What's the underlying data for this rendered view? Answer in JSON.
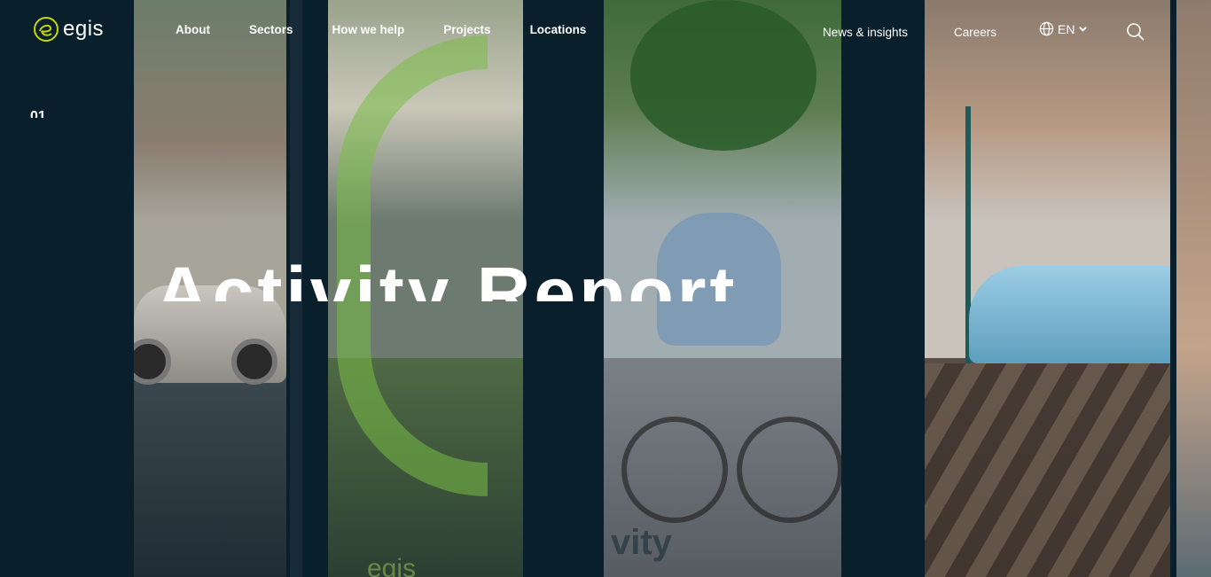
{
  "brand": {
    "name": "egis",
    "accent": "#c5d600",
    "background": "#0a1f2c"
  },
  "nav": {
    "primary": [
      {
        "label": "About"
      },
      {
        "label": "Sectors"
      },
      {
        "label": "How we help"
      },
      {
        "label": "Projects"
      },
      {
        "label": "Locations"
      }
    ],
    "secondary": [
      {
        "label": "News & insights"
      },
      {
        "label": "Careers"
      }
    ],
    "language": {
      "label": "EN",
      "icon": "globe-icon"
    },
    "search": {
      "icon": "search-icon"
    }
  },
  "hero": {
    "slide_number": "01",
    "title": "Activity Report",
    "watermark_logo": "egis",
    "watermark_text": "vity"
  }
}
